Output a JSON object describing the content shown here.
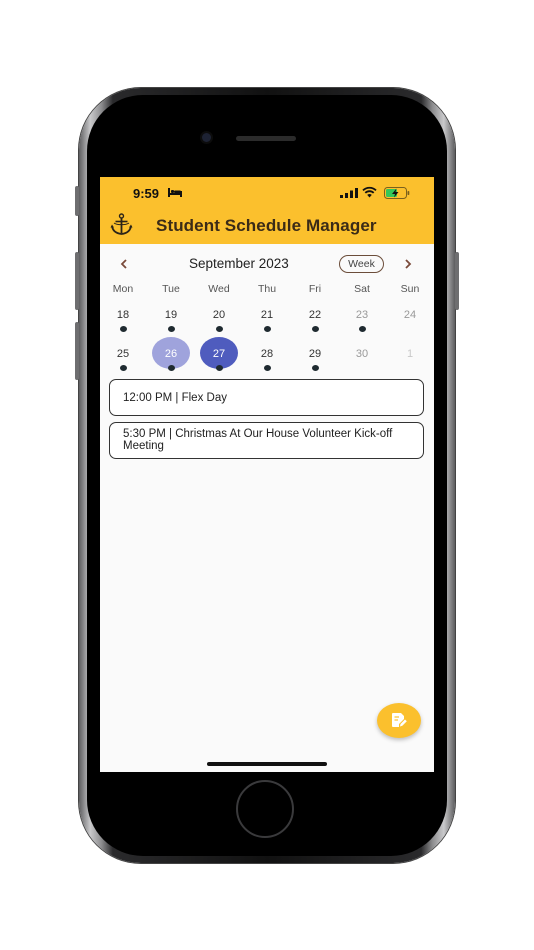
{
  "status_bar": {
    "time": "9:59"
  },
  "app_bar": {
    "title": "Student Schedule Manager"
  },
  "calendar": {
    "month_title": "September 2023",
    "view_toggle_label": "Week",
    "weekdays": [
      "Mon",
      "Tue",
      "Wed",
      "Thu",
      "Fri",
      "Sat",
      "Sun"
    ],
    "weeks": [
      {
        "days": [
          {
            "label": "18",
            "has_event": true
          },
          {
            "label": "19",
            "has_event": true
          },
          {
            "label": "20",
            "has_event": true
          },
          {
            "label": "21",
            "has_event": true
          },
          {
            "label": "22",
            "has_event": true
          },
          {
            "label": "23",
            "has_event": true
          },
          {
            "label": "24",
            "has_event": false
          }
        ]
      },
      {
        "days": [
          {
            "label": "25",
            "has_event": true
          },
          {
            "label": "26",
            "has_event": true,
            "state": "today"
          },
          {
            "label": "27",
            "has_event": true,
            "state": "selected"
          },
          {
            "label": "28",
            "has_event": true
          },
          {
            "label": "29",
            "has_event": true
          },
          {
            "label": "30",
            "has_event": false
          },
          {
            "label": "1",
            "has_event": false,
            "outside_month": true
          }
        ]
      }
    ]
  },
  "events": [
    {
      "text": "12:00 PM | Flex Day"
    },
    {
      "text": "5:30 PM | Christmas At Our House Volunteer Kick-off Meeting"
    }
  ],
  "colors": {
    "accent": "#fbc02d",
    "today_circle": "#9fa3dc",
    "selected_circle": "#4f5cbe",
    "event_dot": "#1f2a30"
  },
  "icons": {
    "logo": "anchor-emblem-icon",
    "fab": "edit-note-icon",
    "prev": "chevron-left-icon",
    "next": "chevron-right-icon"
  }
}
